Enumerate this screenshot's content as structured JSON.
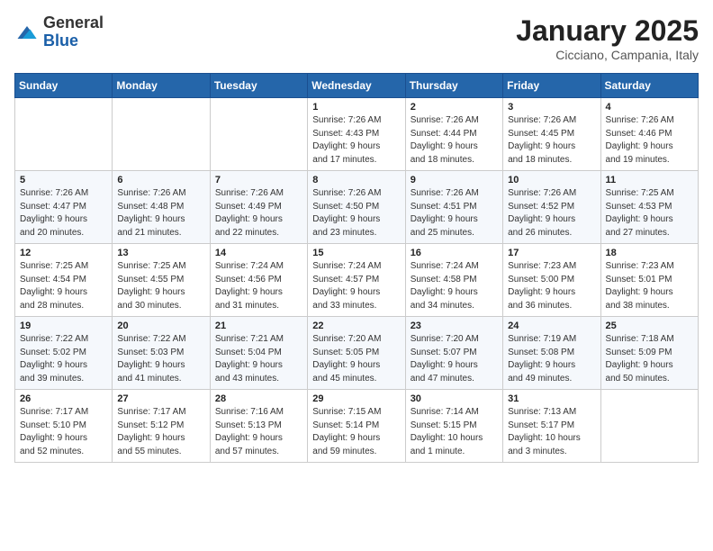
{
  "header": {
    "logo_general": "General",
    "logo_blue": "Blue",
    "month_title": "January 2025",
    "location": "Cicciano, Campania, Italy"
  },
  "weekdays": [
    "Sunday",
    "Monday",
    "Tuesday",
    "Wednesday",
    "Thursday",
    "Friday",
    "Saturday"
  ],
  "weeks": [
    [
      {
        "day": "",
        "info": ""
      },
      {
        "day": "",
        "info": ""
      },
      {
        "day": "",
        "info": ""
      },
      {
        "day": "1",
        "info": "Sunrise: 7:26 AM\nSunset: 4:43 PM\nDaylight: 9 hours\nand 17 minutes."
      },
      {
        "day": "2",
        "info": "Sunrise: 7:26 AM\nSunset: 4:44 PM\nDaylight: 9 hours\nand 18 minutes."
      },
      {
        "day": "3",
        "info": "Sunrise: 7:26 AM\nSunset: 4:45 PM\nDaylight: 9 hours\nand 18 minutes."
      },
      {
        "day": "4",
        "info": "Sunrise: 7:26 AM\nSunset: 4:46 PM\nDaylight: 9 hours\nand 19 minutes."
      }
    ],
    [
      {
        "day": "5",
        "info": "Sunrise: 7:26 AM\nSunset: 4:47 PM\nDaylight: 9 hours\nand 20 minutes."
      },
      {
        "day": "6",
        "info": "Sunrise: 7:26 AM\nSunset: 4:48 PM\nDaylight: 9 hours\nand 21 minutes."
      },
      {
        "day": "7",
        "info": "Sunrise: 7:26 AM\nSunset: 4:49 PM\nDaylight: 9 hours\nand 22 minutes."
      },
      {
        "day": "8",
        "info": "Sunrise: 7:26 AM\nSunset: 4:50 PM\nDaylight: 9 hours\nand 23 minutes."
      },
      {
        "day": "9",
        "info": "Sunrise: 7:26 AM\nSunset: 4:51 PM\nDaylight: 9 hours\nand 25 minutes."
      },
      {
        "day": "10",
        "info": "Sunrise: 7:26 AM\nSunset: 4:52 PM\nDaylight: 9 hours\nand 26 minutes."
      },
      {
        "day": "11",
        "info": "Sunrise: 7:25 AM\nSunset: 4:53 PM\nDaylight: 9 hours\nand 27 minutes."
      }
    ],
    [
      {
        "day": "12",
        "info": "Sunrise: 7:25 AM\nSunset: 4:54 PM\nDaylight: 9 hours\nand 28 minutes."
      },
      {
        "day": "13",
        "info": "Sunrise: 7:25 AM\nSunset: 4:55 PM\nDaylight: 9 hours\nand 30 minutes."
      },
      {
        "day": "14",
        "info": "Sunrise: 7:24 AM\nSunset: 4:56 PM\nDaylight: 9 hours\nand 31 minutes."
      },
      {
        "day": "15",
        "info": "Sunrise: 7:24 AM\nSunset: 4:57 PM\nDaylight: 9 hours\nand 33 minutes."
      },
      {
        "day": "16",
        "info": "Sunrise: 7:24 AM\nSunset: 4:58 PM\nDaylight: 9 hours\nand 34 minutes."
      },
      {
        "day": "17",
        "info": "Sunrise: 7:23 AM\nSunset: 5:00 PM\nDaylight: 9 hours\nand 36 minutes."
      },
      {
        "day": "18",
        "info": "Sunrise: 7:23 AM\nSunset: 5:01 PM\nDaylight: 9 hours\nand 38 minutes."
      }
    ],
    [
      {
        "day": "19",
        "info": "Sunrise: 7:22 AM\nSunset: 5:02 PM\nDaylight: 9 hours\nand 39 minutes."
      },
      {
        "day": "20",
        "info": "Sunrise: 7:22 AM\nSunset: 5:03 PM\nDaylight: 9 hours\nand 41 minutes."
      },
      {
        "day": "21",
        "info": "Sunrise: 7:21 AM\nSunset: 5:04 PM\nDaylight: 9 hours\nand 43 minutes."
      },
      {
        "day": "22",
        "info": "Sunrise: 7:20 AM\nSunset: 5:05 PM\nDaylight: 9 hours\nand 45 minutes."
      },
      {
        "day": "23",
        "info": "Sunrise: 7:20 AM\nSunset: 5:07 PM\nDaylight: 9 hours\nand 47 minutes."
      },
      {
        "day": "24",
        "info": "Sunrise: 7:19 AM\nSunset: 5:08 PM\nDaylight: 9 hours\nand 49 minutes."
      },
      {
        "day": "25",
        "info": "Sunrise: 7:18 AM\nSunset: 5:09 PM\nDaylight: 9 hours\nand 50 minutes."
      }
    ],
    [
      {
        "day": "26",
        "info": "Sunrise: 7:17 AM\nSunset: 5:10 PM\nDaylight: 9 hours\nand 52 minutes."
      },
      {
        "day": "27",
        "info": "Sunrise: 7:17 AM\nSunset: 5:12 PM\nDaylight: 9 hours\nand 55 minutes."
      },
      {
        "day": "28",
        "info": "Sunrise: 7:16 AM\nSunset: 5:13 PM\nDaylight: 9 hours\nand 57 minutes."
      },
      {
        "day": "29",
        "info": "Sunrise: 7:15 AM\nSunset: 5:14 PM\nDaylight: 9 hours\nand 59 minutes."
      },
      {
        "day": "30",
        "info": "Sunrise: 7:14 AM\nSunset: 5:15 PM\nDaylight: 10 hours\nand 1 minute."
      },
      {
        "day": "31",
        "info": "Sunrise: 7:13 AM\nSunset: 5:17 PM\nDaylight: 10 hours\nand 3 minutes."
      },
      {
        "day": "",
        "info": ""
      }
    ]
  ]
}
